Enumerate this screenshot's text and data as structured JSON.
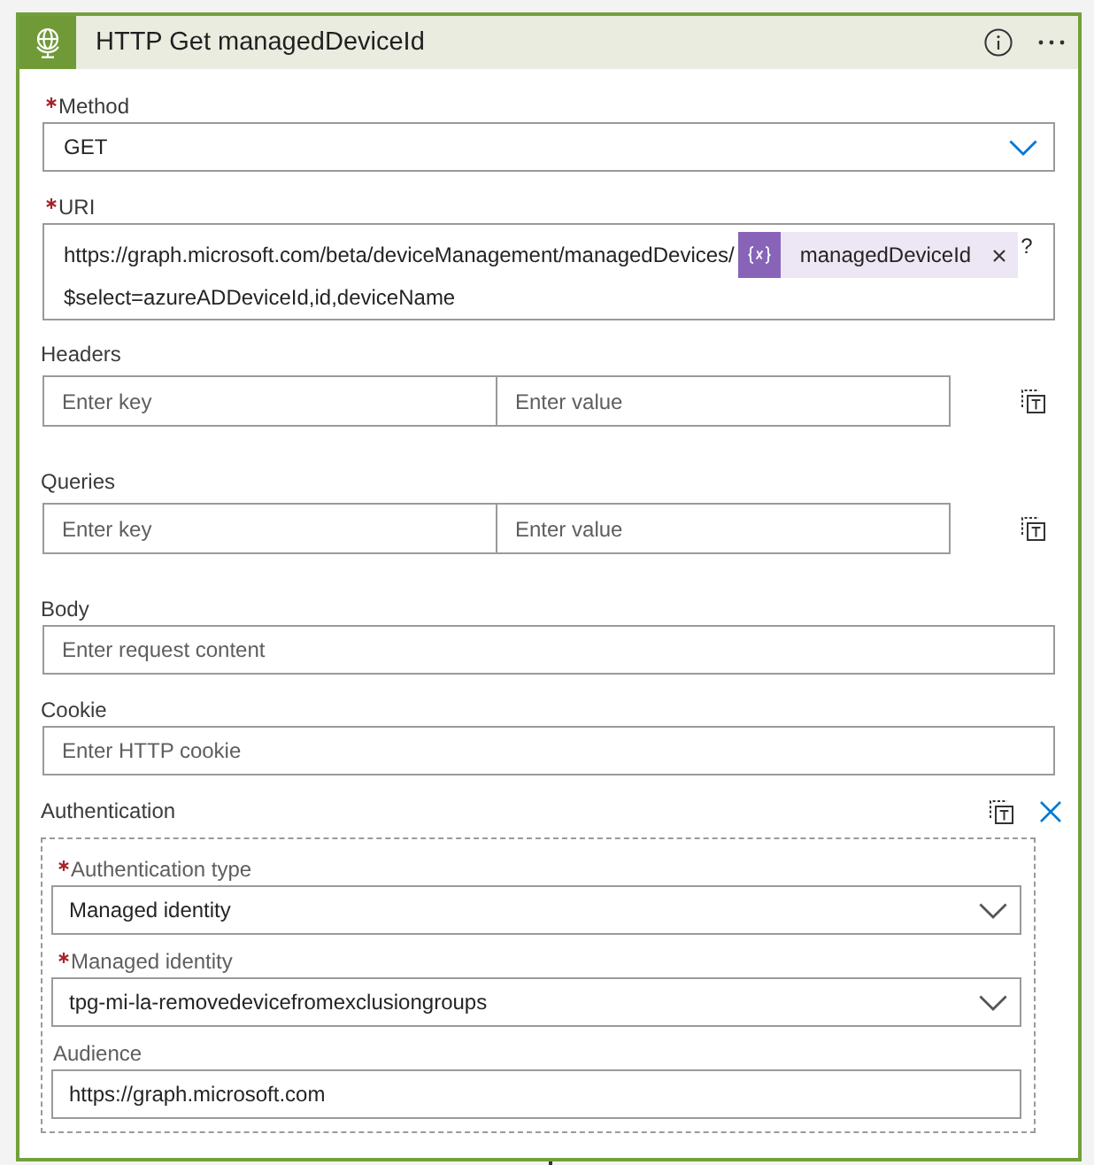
{
  "card": {
    "title": "HTTP Get managedDeviceId"
  },
  "fields": [
    {
      "kind": "dropdown",
      "label": "Method",
      "required": true,
      "value": "GET"
    },
    {
      "kind": "uri",
      "label": "URI",
      "required": true,
      "lines": [
        [
          {
            "kind": "text",
            "text": "https://graph.microsoft.com/beta/deviceManagement/managedDevices/"
          },
          {
            "kind": "token",
            "text": "managedDeviceId"
          },
          {
            "kind": "text",
            "text": "?"
          }
        ],
        [
          {
            "kind": "text",
            "text": "$select=azureADDeviceId,id,deviceName"
          }
        ]
      ]
    },
    {
      "kind": "key_value",
      "label": "Headers",
      "required": false,
      "key_placeholder": "Enter key",
      "value_placeholder": "Enter value"
    },
    {
      "kind": "key_value",
      "label": "Queries",
      "required": false,
      "key_placeholder": "Enter key",
      "value_placeholder": "Enter value"
    },
    {
      "kind": "text",
      "label": "Body",
      "required": false,
      "placeholder": "Enter request content"
    },
    {
      "kind": "text",
      "label": "Cookie",
      "required": false,
      "placeholder": "Enter HTTP cookie"
    },
    {
      "kind": "group",
      "label": "Authentication",
      "required": false,
      "fields": [
        {
          "kind": "dropdown",
          "label": "Authentication type",
          "required": true,
          "value": "Managed identity"
        },
        {
          "kind": "dropdown",
          "label": "Managed identity",
          "required": true,
          "value": "tpg-mi-la-removedevicefromexclusiongroups"
        },
        {
          "kind": "text",
          "label": "Audience",
          "required": false,
          "value": "https://graph.microsoft.com"
        }
      ]
    }
  ]
}
